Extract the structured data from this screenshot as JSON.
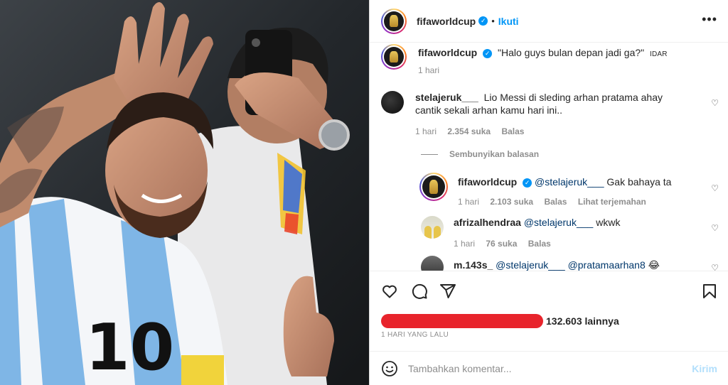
{
  "post": {
    "username": "fifaworldcup",
    "follow_label": "Ikuti",
    "dot": "•"
  },
  "caption": {
    "username": "fifaworldcup",
    "text": "\"Halo guys bulan depan jadi ga?\"",
    "edited_label": "IDAR",
    "time": "1 hari"
  },
  "comments": [
    {
      "username": "stelajeruk___",
      "text": "Lio Messi di sleding arhan pratama ahay cantik sekali arhan kamu hari ini..",
      "time": "1 hari",
      "likes": "2.354 suka",
      "reply": "Balas"
    }
  ],
  "hide_replies_label": "Sembunyikan balasan",
  "replies": [
    {
      "username": "fifaworldcup",
      "mention": "@stelajeruk___",
      "text": "Gak bahaya ta",
      "time": "1 hari",
      "likes": "2.103 suka",
      "reply": "Balas",
      "translate": "Lihat terjemahan"
    },
    {
      "username": "afrizalhendraa",
      "mention": "@stelajeruk___",
      "text": "wkwk",
      "time": "1 hari",
      "likes": "76 suka",
      "reply": "Balas"
    },
    {
      "username": "m.143s_",
      "mention": "@stelajeruk___",
      "mention2": "@pratamaarhan8",
      "emoji": "😂"
    }
  ],
  "likes_count": "132.603 lainnya",
  "post_date": "1 HARI YANG LALU",
  "comment_input": {
    "placeholder": "Tambahkan komentar...",
    "post_label": "Kirim"
  },
  "icons": {
    "more": "more-icon",
    "verified": "verified-icon",
    "heart": "heart-icon",
    "comment": "comment-icon",
    "share": "share-icon",
    "save": "bookmark-icon",
    "emoji": "emoji-icon"
  },
  "colors": {
    "accent": "#0095f6",
    "redaction": "#e8242c",
    "muted": "#8e8e8e"
  }
}
